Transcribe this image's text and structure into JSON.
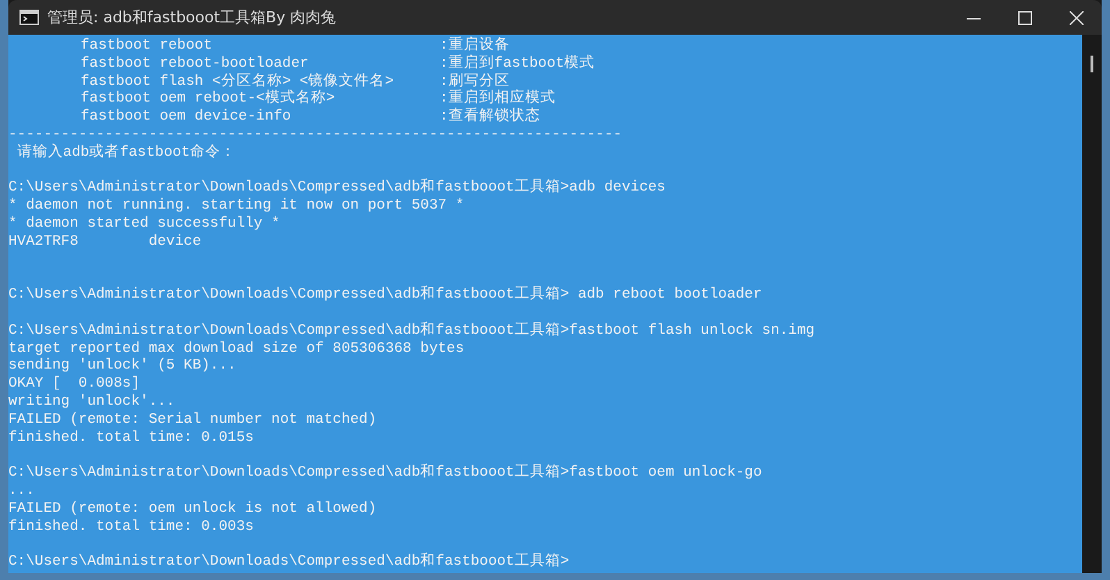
{
  "window": {
    "title": "管理员: adb和fastbooot工具箱By 肉肉兔"
  },
  "console": {
    "lines": [
      {
        "kind": "help",
        "command": "fastboot reboot",
        "description": ":重启设备"
      },
      {
        "kind": "help",
        "command": "fastboot reboot-bootloader",
        "description": ":重启到fastboot模式"
      },
      {
        "kind": "help",
        "command": "fastboot flash <分区名称> <镜像文件名>",
        "description": ":刷写分区"
      },
      {
        "kind": "help",
        "command": "fastboot oem reboot-<模式名称>",
        "description": ":重启到相应模式"
      },
      {
        "kind": "help",
        "command": "fastboot oem device-info",
        "description": ":查看解锁状态"
      },
      {
        "kind": "text",
        "text": "----------------------------------------------------------------------"
      },
      {
        "kind": "text",
        "text": " 请输入adb或者fastboot命令："
      },
      {
        "kind": "blank"
      },
      {
        "kind": "text",
        "text": "C:\\Users\\Administrator\\Downloads\\Compressed\\adb和fastbooot工具箱>adb devices"
      },
      {
        "kind": "text",
        "text": "* daemon not running. starting it now on port 5037 *"
      },
      {
        "kind": "text",
        "text": "* daemon started successfully *"
      },
      {
        "kind": "text",
        "text": "HVA2TRF8        device"
      },
      {
        "kind": "blank"
      },
      {
        "kind": "blank"
      },
      {
        "kind": "text",
        "text": "C:\\Users\\Administrator\\Downloads\\Compressed\\adb和fastbooot工具箱> adb reboot bootloader"
      },
      {
        "kind": "blank"
      },
      {
        "kind": "text",
        "text": "C:\\Users\\Administrator\\Downloads\\Compressed\\adb和fastbooot工具箱>fastboot flash unlock sn.img"
      },
      {
        "kind": "text",
        "text": "target reported max download size of 805306368 bytes"
      },
      {
        "kind": "text",
        "text": "sending 'unlock' (5 KB)..."
      },
      {
        "kind": "text",
        "text": "OKAY [  0.008s]"
      },
      {
        "kind": "text",
        "text": "writing 'unlock'..."
      },
      {
        "kind": "text",
        "text": "FAILED (remote: Serial number not matched)"
      },
      {
        "kind": "text",
        "text": "finished. total time: 0.015s"
      },
      {
        "kind": "blank"
      },
      {
        "kind": "text",
        "text": "C:\\Users\\Administrator\\Downloads\\Compressed\\adb和fastbooot工具箱>fastboot oem unlock-go"
      },
      {
        "kind": "text",
        "text": "..."
      },
      {
        "kind": "text",
        "text": "FAILED (remote: oem unlock is not allowed)"
      },
      {
        "kind": "text",
        "text": "finished. total time: 0.003s"
      },
      {
        "kind": "blank"
      },
      {
        "kind": "text",
        "text": "C:\\Users\\Administrator\\Downloads\\Compressed\\adb和fastbooot工具箱>"
      }
    ]
  }
}
